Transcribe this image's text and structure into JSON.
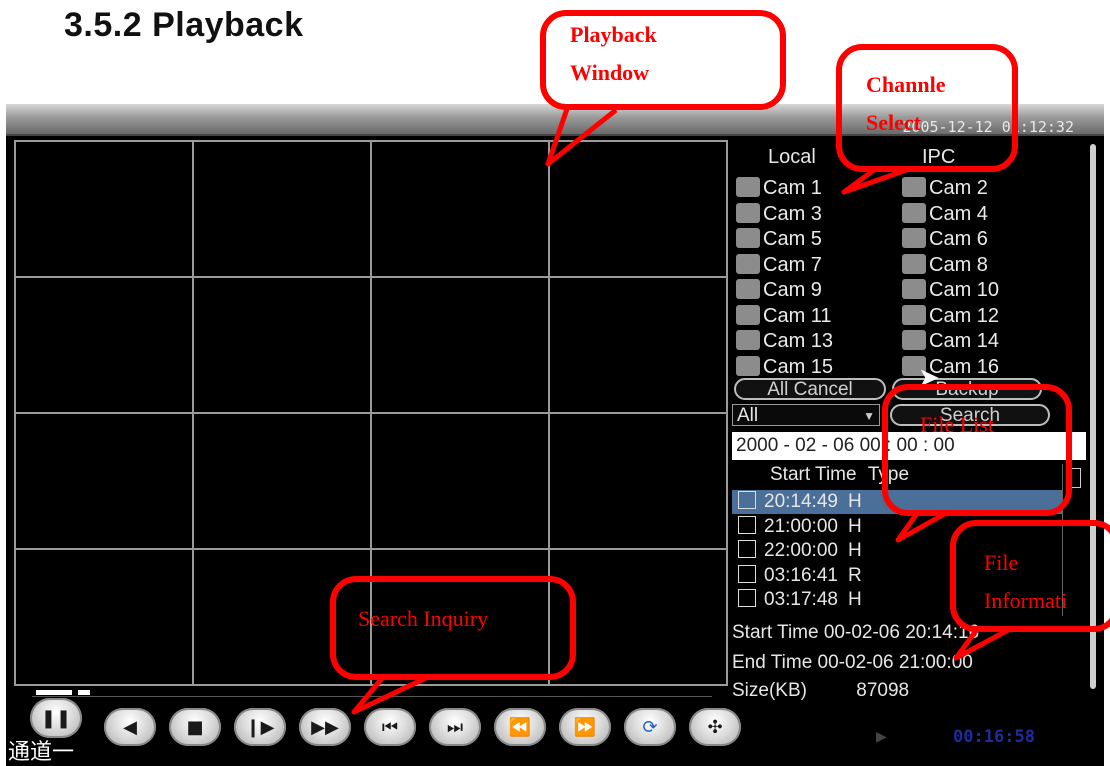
{
  "heading": "3.5.2 Playback",
  "clock": "2005-12-12 01:12:32",
  "tabs": [
    "Local",
    "IPC"
  ],
  "cameras": [
    "Cam 1",
    "Cam 2",
    "Cam 3",
    "Cam 4",
    "Cam 5",
    "Cam 6",
    "Cam 7",
    "Cam 8",
    "Cam 9",
    "Cam 10",
    "Cam 11",
    "Cam 12",
    "Cam 13",
    "Cam 14",
    "Cam 15",
    "Cam 16"
  ],
  "buttons": {
    "all_cancel": "All Cancel",
    "backup": "Backup",
    "search": "Search"
  },
  "type_select": {
    "value": "All"
  },
  "date_field": "2000 - 02 - 06   00 : 00 : 00",
  "file_list": {
    "headers": [
      "Start Time",
      "Type"
    ],
    "rows": [
      {
        "time": "20:14:49",
        "type": "H"
      },
      {
        "time": "21:00:00",
        "type": "H"
      },
      {
        "time": "22:00:00",
        "type": "H"
      },
      {
        "time": "03:16:41",
        "type": "R"
      },
      {
        "time": "03:17:48",
        "type": "H"
      }
    ],
    "selected_index": 0
  },
  "file_info": {
    "start": "Start Time 00-02-06 20:14:16",
    "end": "End Time 00-02-06 21:00:00",
    "size_label": "Size(KB)",
    "size_value": "87098"
  },
  "channel_label": "通道一",
  "playback_time": "00:16:58",
  "control_icons": [
    "pause-icon",
    "play-reverse-icon",
    "stop-icon",
    "slow-play-icon",
    "fast-forward-icon",
    "previous-frame-icon",
    "next-frame-icon",
    "previous-file-icon",
    "next-file-icon",
    "repeat-icon",
    "fullscreen-icon"
  ],
  "callouts": {
    "playback_window": [
      "Playback",
      "Window"
    ],
    "channel_select": [
      "Channle",
      "Select"
    ],
    "file_list": "File List",
    "file_info": [
      "File",
      "Informati"
    ],
    "search_inquiry": "Search Inquiry"
  },
  "colors": {
    "callout": "#ff0000",
    "selected_row": "#4a6f99"
  }
}
